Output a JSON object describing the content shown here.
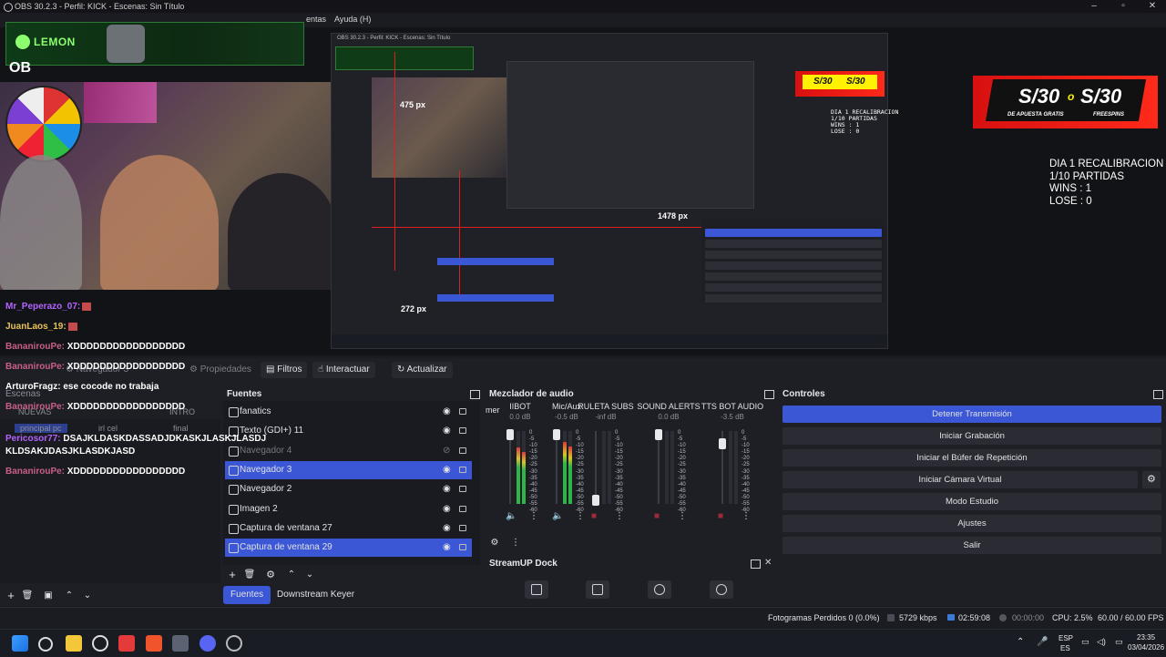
{
  "window": {
    "title": "OBS 30.2.3 - Perfil: KICK - Escenas: Sin Título",
    "menu_fragment": "entas",
    "menu_help": "Ayuda (H)"
  },
  "overlay": {
    "lemon_label": "LEMON",
    "ob_text": "OB",
    "nested_title": "OBS 30.2.3 - Perfil: KICK - Escenas: Sin Título",
    "measure_labels": [
      "475 px",
      "1478 px",
      "272 px"
    ],
    "stats_small": [
      "DIA 1 RECALIBRACION",
      "1/10 PARTIDAS",
      "WINS   : 1",
      "LOSE   : 0"
    ],
    "stats_large": [
      "DIA 1 RECALIBRACION",
      "1/10 PARTIDAS",
      "WINS   :  1",
      "LOSE   :  0"
    ],
    "banner": {
      "amount1": "S/30",
      "conj": "o",
      "amount2": "S/30",
      "sub1": "DE APUESTA GRATIS",
      "sub2": "FREESPINS"
    }
  },
  "chat": [
    {
      "user": "Mr_Peperazo_07:",
      "msg": "",
      "color": "#b463ff"
    },
    {
      "user": "JuanLaos_19:",
      "msg": "",
      "color": "#e9c35a"
    },
    {
      "user": "BananirouPe:",
      "msg": "XDDDDDDDDDDDDDDDDD",
      "color": "#c85f8a"
    },
    {
      "user": "BananirouPe:",
      "msg": "XDDDDDDDDDDDDDDDDD",
      "color": "#c85f8a"
    },
    {
      "user": "ArturoFragz:",
      "msg": "ese cocode no trabaja",
      "color": "#e9c35a"
    },
    {
      "user": "BananirouPe:",
      "msg": "XDDDDDDDDDDDDDDDDD",
      "color": "#c85f8a"
    },
    {
      "user": "Pericosor77:",
      "msg": "DSAJKLDASKDASSADJDKASKJLASKJLASDJ",
      "color": "#b463ff"
    },
    {
      "user": "",
      "msg": "KLDSAKJDASJKLASDKJASD",
      "color": "#ffffff"
    },
    {
      "user": "BananirouPe:",
      "msg": "XDDDDDDDDDDDDDDDDD",
      "color": "#c85f8a"
    }
  ],
  "toolbar": {
    "source_name": "Navegador 3",
    "properties": "Propiedades",
    "filters": "Filtros",
    "interact": "Interactuar",
    "refresh": "Actualizar"
  },
  "scenes": {
    "header": "Escenas",
    "items": [
      "principal pc",
      "irl cel",
      "final",
      "NUEVAS",
      "INTRO"
    ]
  },
  "sources": {
    "header": "Fuentes",
    "items": [
      {
        "label": "fanatics",
        "selected": false,
        "hidden": false
      },
      {
        "label": "Texto (GDI+) 11",
        "selected": false,
        "hidden": false
      },
      {
        "label": "Navegador 4",
        "selected": false,
        "hidden": true
      },
      {
        "label": "Navegador 3",
        "selected": true,
        "hidden": false
      },
      {
        "label": "Navegador 2",
        "selected": false,
        "hidden": false
      },
      {
        "label": "Imagen 2",
        "selected": false,
        "hidden": false
      },
      {
        "label": "Captura de ventana 27",
        "selected": false,
        "hidden": false
      },
      {
        "label": "Captura de ventana 29",
        "selected": true,
        "hidden": false
      }
    ],
    "tabs": [
      "Fuentes",
      "Downstream Keyer"
    ]
  },
  "mixer": {
    "header": "Mezclador de audio",
    "truncated": "mer",
    "channels": [
      {
        "name": "IIBOT",
        "db": "0.0 dB",
        "level": 0.78,
        "fader": 0.95
      },
      {
        "name": "Mic/Aux",
        "db": "-0.5 dB",
        "level": 0.85,
        "fader": 0.95
      },
      {
        "name": "RULETA SUBS",
        "db": "-inf dB",
        "level": 0.0,
        "fader": 0.05
      },
      {
        "name": "SOUND ALERTS",
        "db": "0.0 dB",
        "level": 0.0,
        "fader": 0.95
      },
      {
        "name": "TTS BOT AUDIO",
        "db": "-3.5 dB",
        "level": 0.0,
        "fader": 0.82
      }
    ],
    "scale": [
      "0",
      "-5",
      "-10",
      "-15",
      "-20",
      "-25",
      "-30",
      "-35",
      "-40",
      "-45",
      "-50",
      "-55",
      "-60"
    ]
  },
  "streamup": {
    "header": "StreamUP Dock"
  },
  "controls": {
    "header": "Controles",
    "buttons": [
      "Detener Transmisión",
      "Iniciar Grabación",
      "Iniciar el Búfer de Repetición",
      "Iniciar Cámara Virtual",
      "Modo Estudio",
      "Ajustes",
      "Salir"
    ]
  },
  "status": {
    "dropped": "Fotogramas Perdidos 0 (0.0%)",
    "bitrate": "5729 kbps",
    "live_time": "02:59:08",
    "rec_time": "00:00:00",
    "cpu": "CPU: 2.5%",
    "fps": "60.00 / 60.00 FPS"
  },
  "tray": {
    "lang1": "ESP",
    "lang2": "ES",
    "time": "23:35",
    "date": "03/04/2026"
  },
  "colors": {
    "accent": "#3b57d6",
    "bg": "#1e1f25",
    "live": "#3b57d6"
  }
}
